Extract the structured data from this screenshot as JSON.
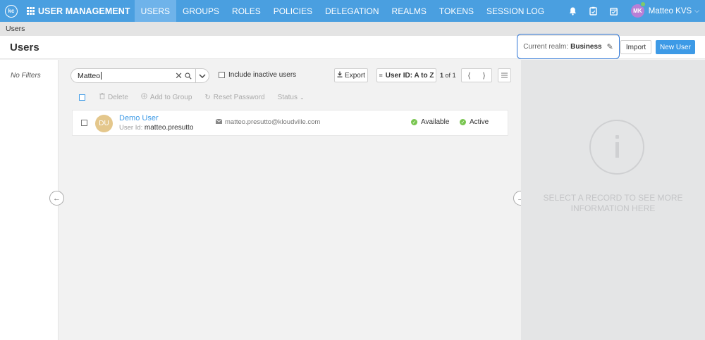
{
  "nav": {
    "logo_text": "kc",
    "app_title": "USER MANAGEMENT",
    "items": [
      {
        "label": "USERS",
        "active": true
      },
      {
        "label": "GROUPS",
        "active": false
      },
      {
        "label": "ROLES",
        "active": false
      },
      {
        "label": "POLICIES",
        "active": false
      },
      {
        "label": "DELEGATION",
        "active": false
      },
      {
        "label": "REALMS",
        "active": false
      },
      {
        "label": "TOKENS",
        "active": false
      },
      {
        "label": "SESSION LOG",
        "active": false
      }
    ],
    "icons": [
      "bell-icon",
      "clipboard-icon",
      "calendar-check-icon"
    ],
    "user_initials": "MK",
    "user_name": "Matteo KVS"
  },
  "breadcrumb": "Users",
  "header": {
    "title": "Users",
    "realm_label": "Current realm:",
    "realm_value": "Business",
    "import_label": "Import",
    "new_user_label": "New User"
  },
  "filters": {
    "empty_text": "No Filters"
  },
  "toolbar": {
    "search_value": "Matteo",
    "include_inactive_label": "Include inactive users",
    "export_label": "Export",
    "sort_label": "User ID: A to Z",
    "page_current": "1",
    "page_of": "of",
    "page_total": "1"
  },
  "bulk_actions": {
    "delete": "Delete",
    "add_to_group": "Add to Group",
    "reset_password": "Reset Password",
    "status": "Status"
  },
  "users": [
    {
      "initials": "DU",
      "name": "Demo User",
      "user_id_label": "User Id:",
      "user_id": "matteo.presutto",
      "email": "matteo.presutto@kloudville.com",
      "availability": "Available",
      "state": "Active"
    }
  ],
  "detail": {
    "placeholder": "SELECT A RECORD TO SEE MORE INFORMATION HERE"
  },
  "colors": {
    "nav_bg": "#4a9fe0",
    "nav_active": "#6fb3ea",
    "primary": "#3d9ae6",
    "realm_highlight": "#2f76d6",
    "status_green": "#78c54f",
    "avatar_du": "#e4c78c",
    "avatar_mk": "#b87fd6"
  }
}
